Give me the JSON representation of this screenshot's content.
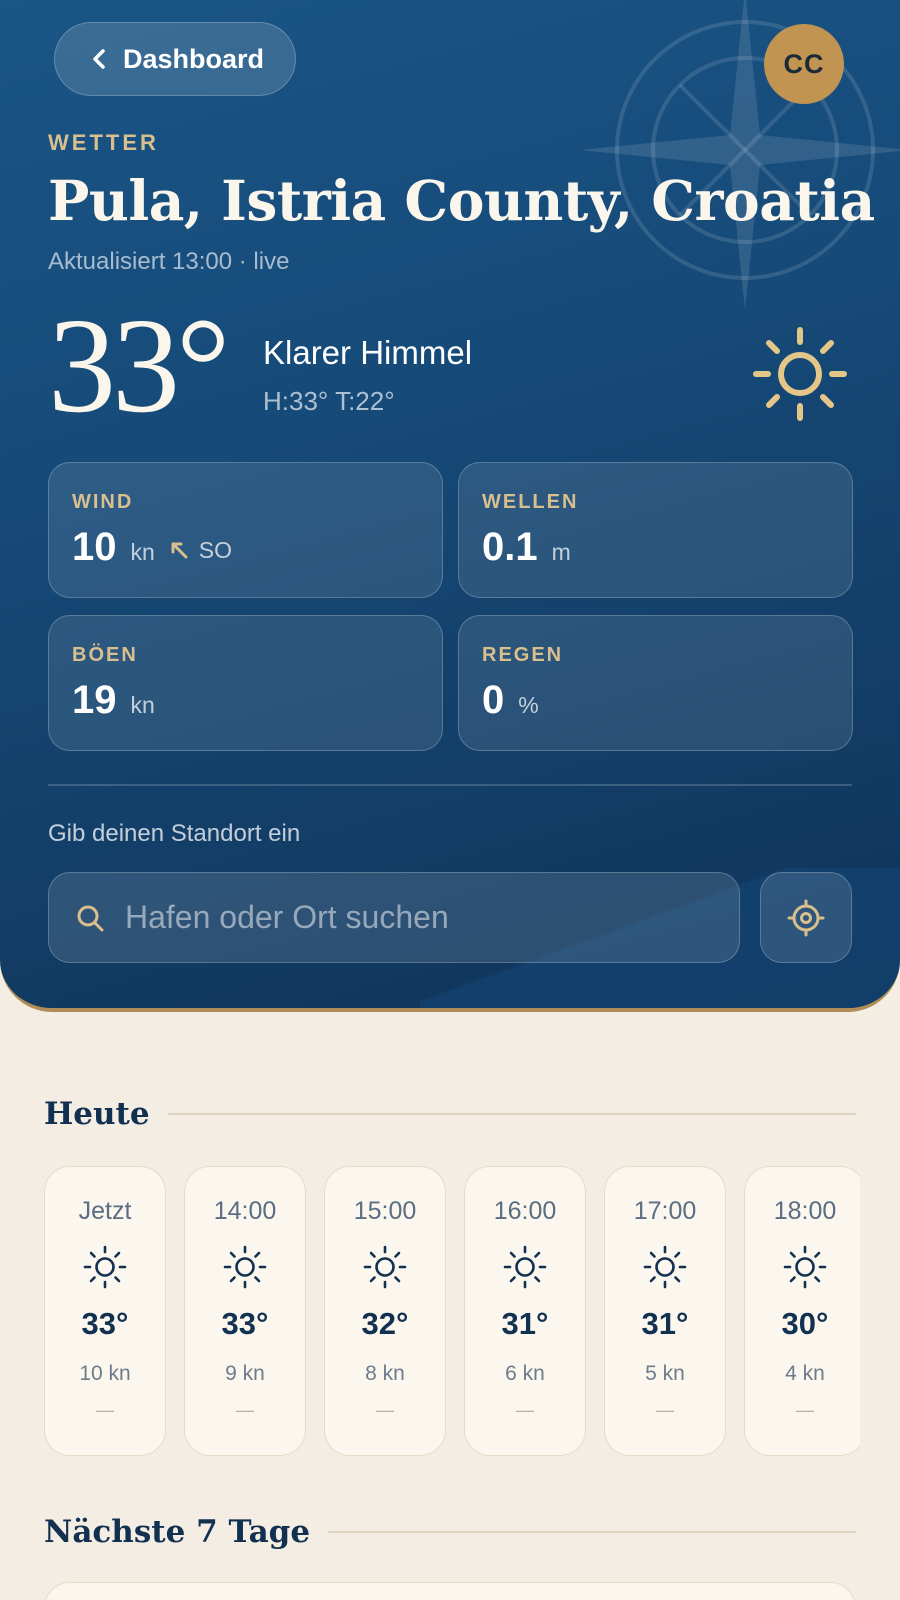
{
  "header": {
    "back_label": "Dashboard",
    "avatar_initials": "CC",
    "eyebrow": "WETTER",
    "location": "Pula, Istria County, Croatia",
    "updated": "Aktualisiert 13:00 · live"
  },
  "current": {
    "temperature": "33°",
    "condition": "Klarer Himmel",
    "hilo": "H:33° T:22°",
    "icon": "sun-icon"
  },
  "metrics": {
    "wind": {
      "label": "WIND",
      "value": "10",
      "unit": "kn",
      "direction": "SO",
      "icon": "wind-arrow-icon"
    },
    "waves": {
      "label": "WELLEN",
      "value": "0.1",
      "unit": "m"
    },
    "gusts": {
      "label": "BÖEN",
      "value": "19",
      "unit": "kn"
    },
    "rain": {
      "label": "REGEN",
      "value": "0",
      "unit": "%"
    }
  },
  "search": {
    "prompt": "Gib deinen Standort ein",
    "placeholder": "Hafen oder Ort suchen",
    "value": ""
  },
  "today": {
    "title": "Heute",
    "hours": [
      {
        "time": "Jetzt",
        "temp": "33°",
        "wind": "10 kn",
        "rain": "—",
        "icon": "sun-icon"
      },
      {
        "time": "14:00",
        "temp": "33°",
        "wind": "9 kn",
        "rain": "—",
        "icon": "sun-icon"
      },
      {
        "time": "15:00",
        "temp": "32°",
        "wind": "8 kn",
        "rain": "—",
        "icon": "sun-icon"
      },
      {
        "time": "16:00",
        "temp": "31°",
        "wind": "6 kn",
        "rain": "—",
        "icon": "sun-icon"
      },
      {
        "time": "17:00",
        "temp": "31°",
        "wind": "5 kn",
        "rain": "—",
        "icon": "sun-icon"
      },
      {
        "time": "18:00",
        "temp": "30°",
        "wind": "4 kn",
        "rain": "—",
        "icon": "sun-icon"
      }
    ]
  },
  "week": {
    "title": "Nächste 7 Tage"
  },
  "colors": {
    "accent": "#c19452",
    "gold_text": "#d9bf8d",
    "navy": "#12304f",
    "background": "#f3ede3"
  }
}
